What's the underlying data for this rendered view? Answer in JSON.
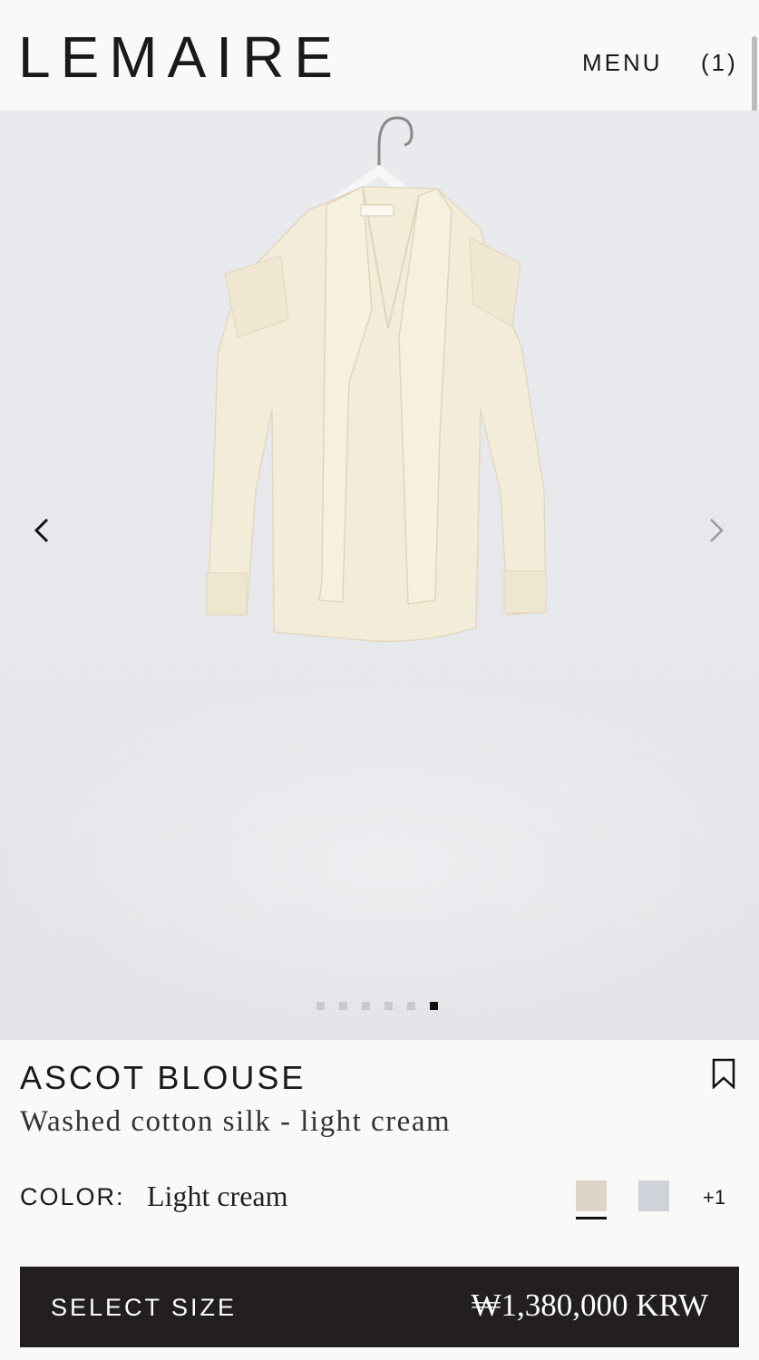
{
  "header": {
    "logo": "LEMAIRE",
    "menu_label": "MENU",
    "cart_count": "(1)"
  },
  "gallery": {
    "prev_icon": "chevron-left-icon",
    "next_icon": "chevron-right-icon",
    "image_count": 6,
    "active_index": 5,
    "garment_color": "#f3ecd9"
  },
  "product": {
    "name": "ASCOT BLOUSE",
    "subtitle": "Washed cotton silk - light cream",
    "bookmark_icon": "bookmark-icon",
    "color_label": "COLOR:",
    "color_value": "Light cream",
    "swatches": [
      {
        "name": "Light cream",
        "hex": "#ddd6c8",
        "selected": true
      },
      {
        "name": "Light blue",
        "hex": "#cdd3d9",
        "selected": false
      }
    ],
    "more_colors": "+1",
    "select_size_label": "SELECT SIZE",
    "price": "₩1,380,000 KRW"
  },
  "colors": {
    "background": "#faf9f7",
    "button_bg": "#231f20",
    "text": "#1a1a1a"
  }
}
